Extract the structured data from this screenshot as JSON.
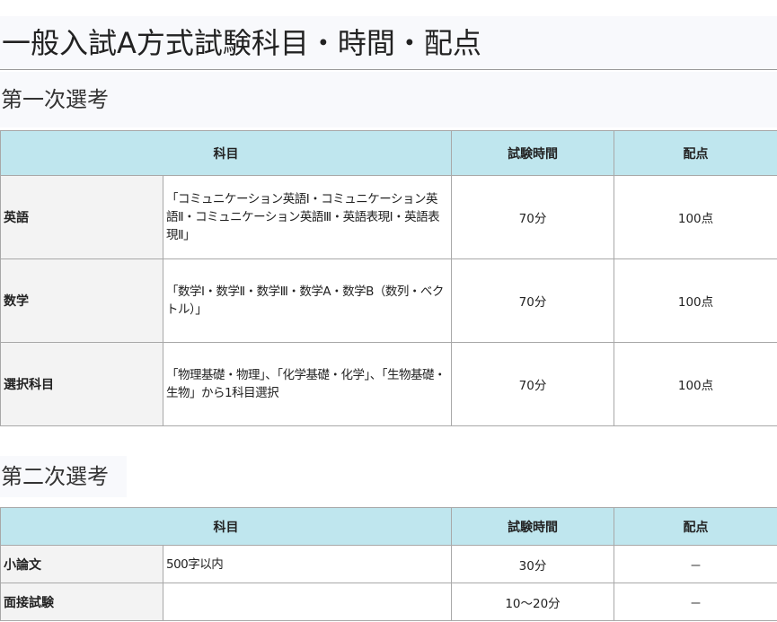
{
  "page_title": "一般入試A方式試験科目・時間・配点",
  "first_exam": {
    "heading": "第一次選考",
    "headers": {
      "subject": "科目",
      "time": "試験時間",
      "score": "配点"
    },
    "rows": [
      {
        "subject": "英語",
        "content": "「コミュニケーション英語Ⅰ・コミュニケーション英語Ⅱ・コミュニケーション英語Ⅲ・英語表現Ⅰ・英語表現Ⅱ」",
        "time": "70分",
        "score": "100点"
      },
      {
        "subject": "数学",
        "content": "「数学Ⅰ・数学Ⅱ・数学Ⅲ・数学A・数学B（数列・ベクトル）」",
        "time": "70分",
        "score": "100点"
      },
      {
        "subject": "選択科目",
        "content": "「物理基礎・物理」、「化学基礎・化学」、「生物基礎・生物」から1科目選択",
        "time": "70分",
        "score": "100点"
      }
    ]
  },
  "second_exam": {
    "heading": "第二次選考",
    "headers": {
      "subject": "科目",
      "time": "試験時間",
      "score": "配点"
    },
    "rows": [
      {
        "subject": "小論文",
        "content": "500字以内",
        "time": "30分",
        "score": "－"
      },
      {
        "subject": "面接試験",
        "content": "",
        "time": "10～20分",
        "score": "－"
      }
    ]
  }
}
